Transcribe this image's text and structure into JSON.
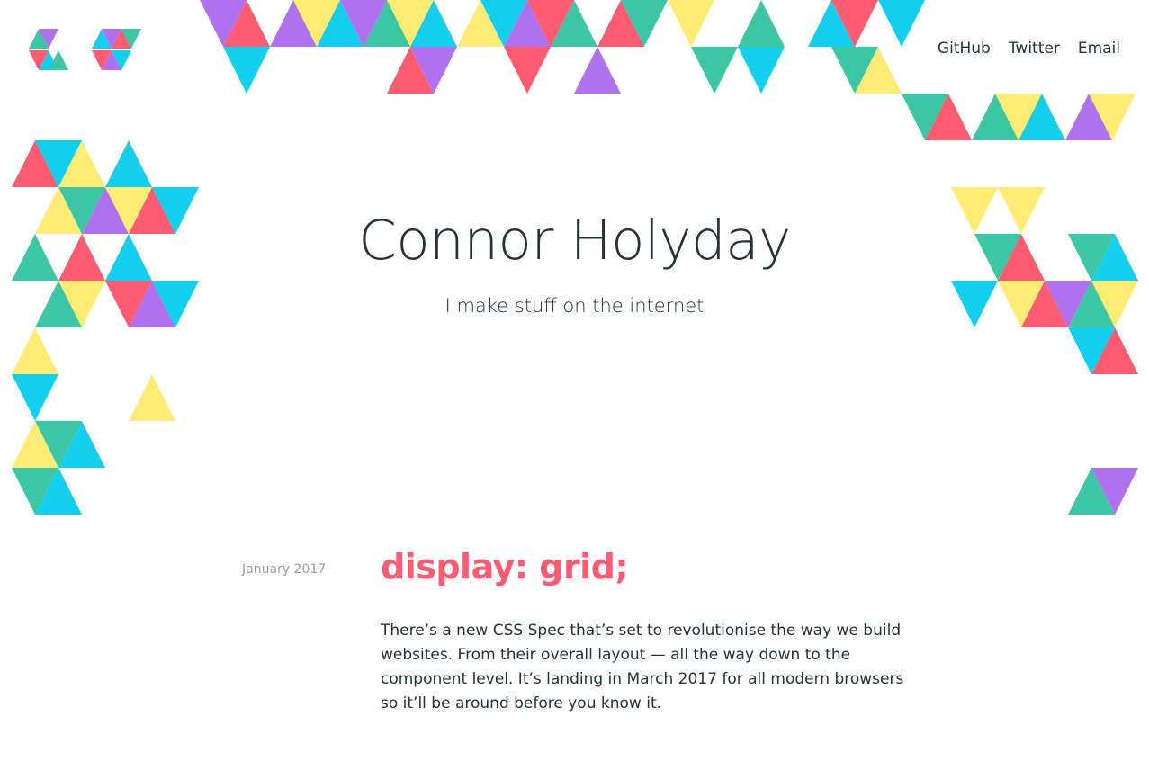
{
  "site": {
    "logo_icon": "triangle-mosaic-logo-icon"
  },
  "nav": {
    "items": [
      {
        "label": "GitHub"
      },
      {
        "label": "Twitter"
      },
      {
        "label": "Email"
      }
    ]
  },
  "hero": {
    "title": "Connor Holyday",
    "subtitle": "I make stuff on the internet"
  },
  "post": {
    "date": "January 2017",
    "title": "display: grid;",
    "excerpt": "There’s a new CSS Spec that’s set to revolutionise the way we build websites. From their overall layout — all the way down to the component level. It’s landing in March 2017 for all modern browsers so it’ll be around before you know it."
  },
  "colors": {
    "purple": "#b071ef",
    "red": "#ff5c72",
    "yellow": "#ffec75",
    "green": "#3cc6a4",
    "cyan": "#13ceec",
    "title_accent": "#ff5b74"
  }
}
